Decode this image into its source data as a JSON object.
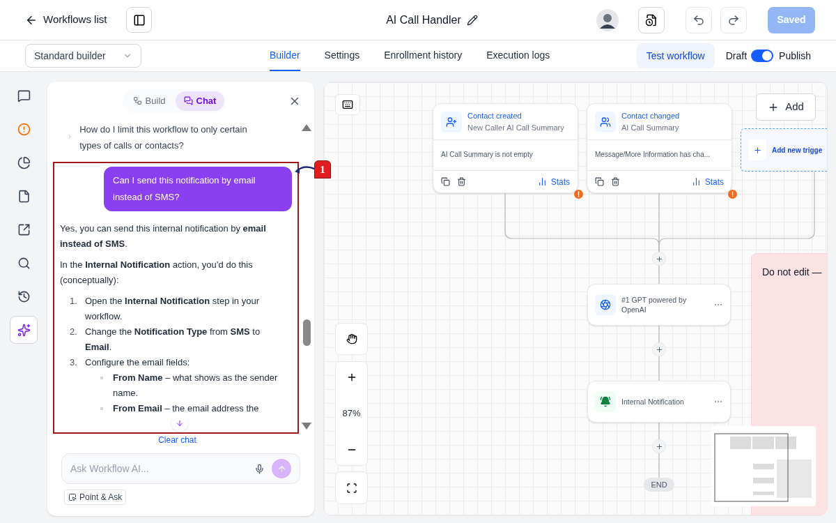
{
  "header": {
    "back_label": "Workflows list",
    "title": "AI Call Handler",
    "save_button": {
      "label": "Saved",
      "disabled": true
    }
  },
  "toolbar": {
    "builder_select": {
      "value": "Standard builder"
    },
    "tabs": [
      {
        "label": "Builder",
        "selected": true
      },
      {
        "label": "Settings",
        "selected": false
      },
      {
        "label": "Enrollment history",
        "selected": false
      },
      {
        "label": "Execution logs",
        "selected": false
      }
    ],
    "test_button": "Test workflow",
    "draft_label": "Draft",
    "publish_toggle": {
      "on": true
    },
    "publish_label": "Publish"
  },
  "rail_items": [
    {
      "kind": "chat",
      "selected": false
    },
    {
      "kind": "alert",
      "selected": false
    },
    {
      "kind": "chart",
      "selected": false
    },
    {
      "kind": "file",
      "selected": false
    },
    {
      "kind": "external",
      "selected": false
    },
    {
      "kind": "search",
      "selected": false
    },
    {
      "kind": "history",
      "selected": false
    },
    {
      "kind": "ai",
      "selected": true
    }
  ],
  "chat_panel": {
    "tabs": [
      {
        "label": "Build",
        "kind": "build",
        "selected": false
      },
      {
        "label": "Chat",
        "kind": "chat",
        "selected": true
      }
    ],
    "suggestion": "How do I limit this workflow to only certain types of calls or contacts?",
    "annotation": {
      "label": "1"
    },
    "user_message": "Can I send this notification by email instead of SMS?",
    "assistant_blocks": [
      {
        "kind": "paragraph",
        "text": "Yes, you can send this internal notification by **email instead of SMS**."
      },
      {
        "kind": "paragraph",
        "text": "In the **Internal Notification** action, you’d do this (conceptually):"
      },
      {
        "kind": "ordered",
        "items": [
          {
            "number": "1.",
            "text": "Open the **Internal Notification** step in your workflow."
          },
          {
            "number": "2.",
            "text": "Change the **Notification Type** from **SMS** to **Email**."
          },
          {
            "number": "3.",
            "text": "Configure the email fields:",
            "children": [
              {
                "text": "**From Name** – what shows as the sender name."
              },
              {
                "text": "**From Email** – the email address the"
              }
            ]
          }
        ]
      }
    ],
    "clear_label": "Clear chat",
    "input": {
      "placeholder": "Ask Workflow AI..."
    },
    "point_ask": "Point & Ask"
  },
  "canvas": {
    "triggers": [
      {
        "kind": "created",
        "title": "Contact created",
        "subtitle": "New Caller AI Call Summary",
        "condition": "AI Call Summary is not empty",
        "stats_label": "Stats",
        "warning": true
      },
      {
        "kind": "changed",
        "title": "Contact changed",
        "subtitle": "AI Call Summary",
        "condition": "Message/More Information has cha...",
        "stats_label": "Stats",
        "warning": true
      }
    ],
    "add_button": "Add",
    "add_trigger": "Add new trigge",
    "actions": [
      {
        "kind": "gpt",
        "title": "#1 GPT powered by OpenAI"
      },
      {
        "kind": "notification",
        "title": "Internal Notification"
      }
    ],
    "end_label": "END",
    "zoom": "87%",
    "note": {
      "text": "Do not edit —"
    }
  }
}
